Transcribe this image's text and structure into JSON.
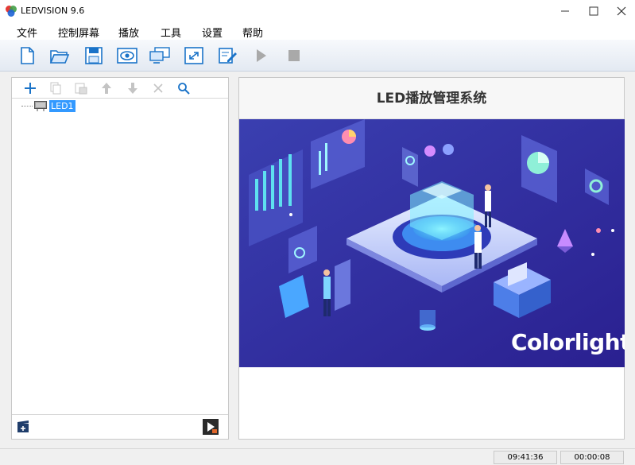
{
  "window": {
    "title": "LEDVISION 9.6"
  },
  "menu": [
    {
      "label": "文件"
    },
    {
      "label": "控制屏幕"
    },
    {
      "label": "播放"
    },
    {
      "label": "工具"
    },
    {
      "label": "设置"
    },
    {
      "label": "帮助"
    }
  ],
  "toolbar": {
    "icons": [
      "new-file-icon",
      "open-folder-icon",
      "save-icon",
      "preview-eye-icon",
      "display-screens-icon",
      "fullscreen-icon",
      "edit-icon",
      "play-icon",
      "stop-icon"
    ],
    "accent": "#1a73c8"
  },
  "tree_toolbar": {
    "icons": [
      "add-icon",
      "copy-icon",
      "paste-icon",
      "move-up-icon",
      "move-down-icon",
      "delete-icon",
      "search-icon"
    ]
  },
  "tree": {
    "items": [
      {
        "label": "LED1",
        "selected": true,
        "icon": "screen-icon"
      }
    ]
  },
  "left_footer": {
    "icons": [
      "add-program-icon",
      "media-play-icon"
    ]
  },
  "banner": {
    "title": "LED播放管理系统",
    "brand": "Colorlight",
    "bg_color": "#2a2f9c"
  },
  "statusbar": {
    "time1": "09:41:36",
    "time2": "00:00:08"
  }
}
